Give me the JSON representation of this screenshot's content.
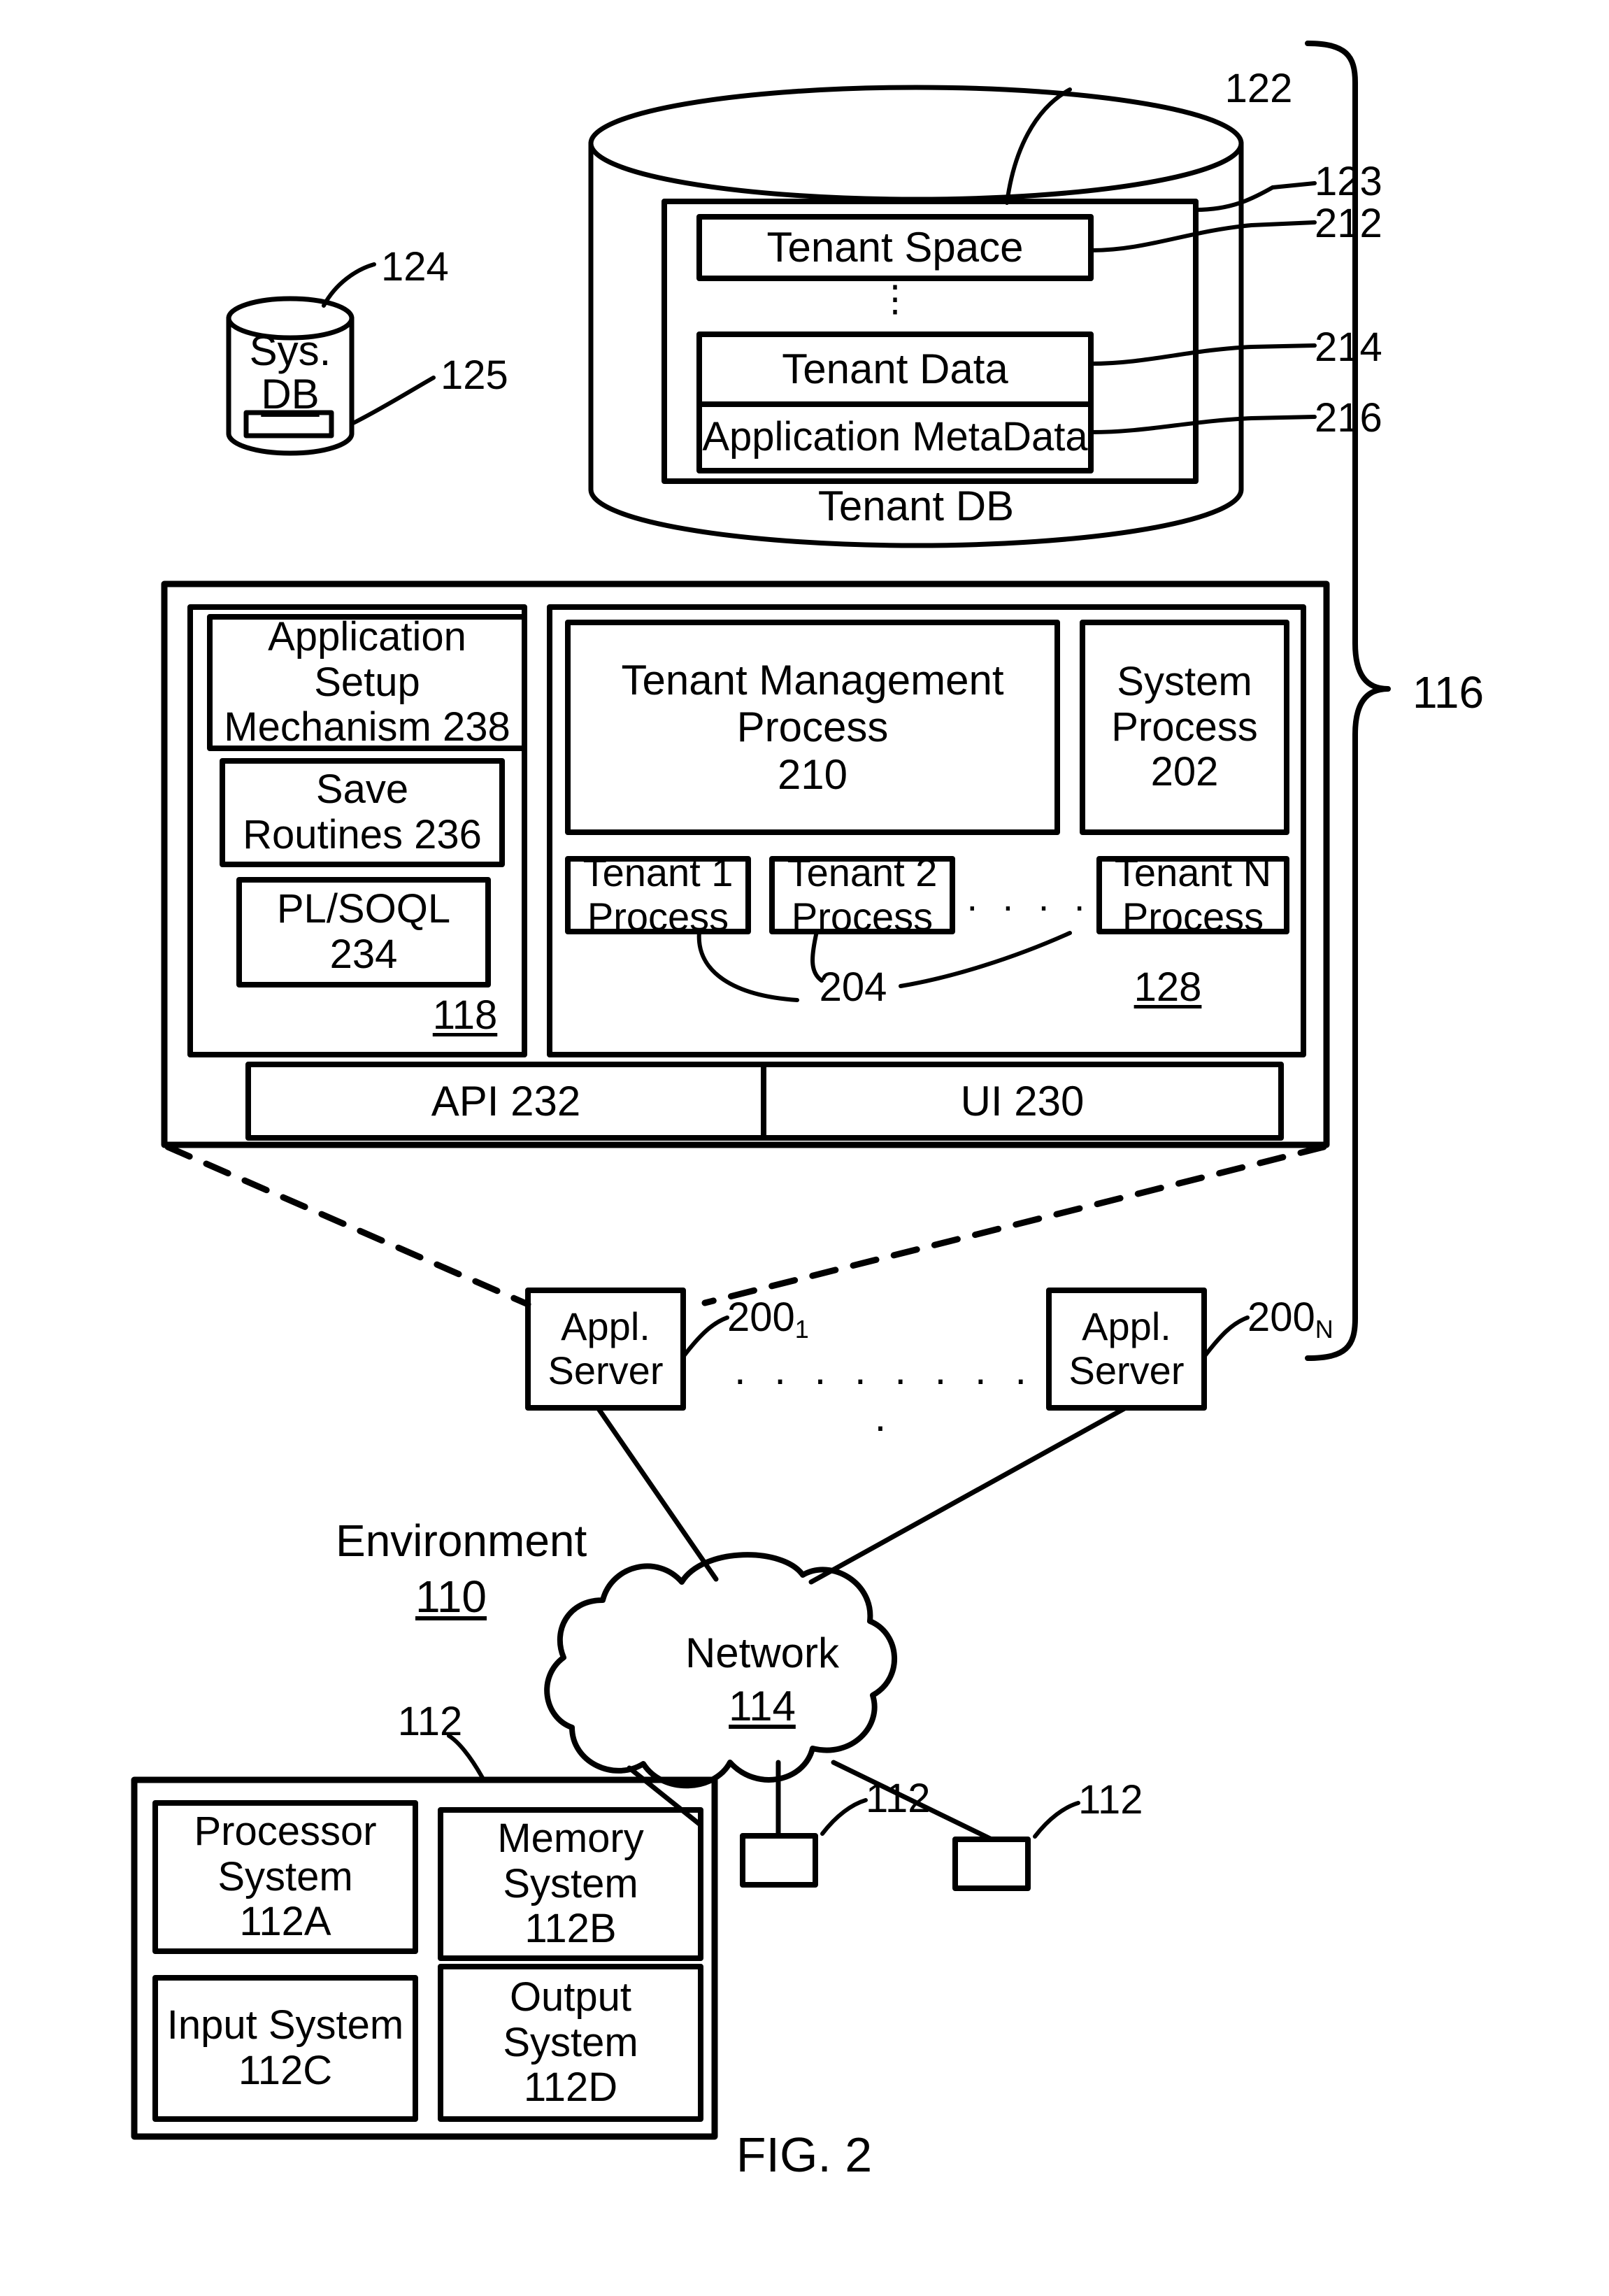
{
  "figure": {
    "caption": "FIG. 2",
    "environment_label": "Environment",
    "environment_ref": "110"
  },
  "tenant_db": {
    "cylinder_label": "Tenant DB",
    "ref_cylinder": "122",
    "ref_outer_space": "123",
    "inner_boxes": [
      {
        "label": "Tenant Space",
        "ref": "212"
      },
      {
        "label": "Tenant Data",
        "ref": "214"
      },
      {
        "label": "Application MetaData",
        "ref": "216"
      }
    ],
    "vertical_ellipsis": "⋮"
  },
  "sys_db": {
    "line1": "Sys.",
    "line2": "DB",
    "ref_cylinder": "124",
    "ref_slot": "125"
  },
  "platform": {
    "ref_bracket": "116",
    "left_panel": {
      "ref": "118",
      "boxes": [
        {
          "label": "Application\nSetup\nMechanism 238"
        },
        {
          "label": "Save\nRoutines 236"
        },
        {
          "label": "PL/SOQL\n234"
        }
      ]
    },
    "right_panel": {
      "ref": "128",
      "process_ref": "204",
      "ellipsis": ". . . .",
      "boxes": [
        {
          "label": "Tenant Management\nProcess\n210"
        },
        {
          "label": "System\nProcess\n202"
        },
        {
          "label": "Tenant 1\nProcess"
        },
        {
          "label": "Tenant 2\nProcess"
        },
        {
          "label": "Tenant N\nProcess"
        }
      ]
    },
    "bottom_bar": [
      {
        "label": "API 232"
      },
      {
        "label": "UI 230"
      }
    ]
  },
  "app_servers": [
    {
      "label": "Appl.\nServer",
      "ref": "200",
      "ref_sub": "1"
    },
    {
      "label": "Appl.\nServer",
      "ref": "200",
      "ref_sub": "N"
    }
  ],
  "app_server_ellipsis": ". . . . . . . . .",
  "network": {
    "label": "Network",
    "ref": "114"
  },
  "user_system": {
    "ref": "112",
    "boxes": [
      {
        "label": "Processor\nSystem\n112A"
      },
      {
        "label": "Memory\nSystem\n112B"
      },
      {
        "label": "Input System\n112C"
      },
      {
        "label": "Output\nSystem\n112D"
      }
    ]
  },
  "user_devices": [
    {
      "ref": "112"
    },
    {
      "ref": "112"
    }
  ]
}
